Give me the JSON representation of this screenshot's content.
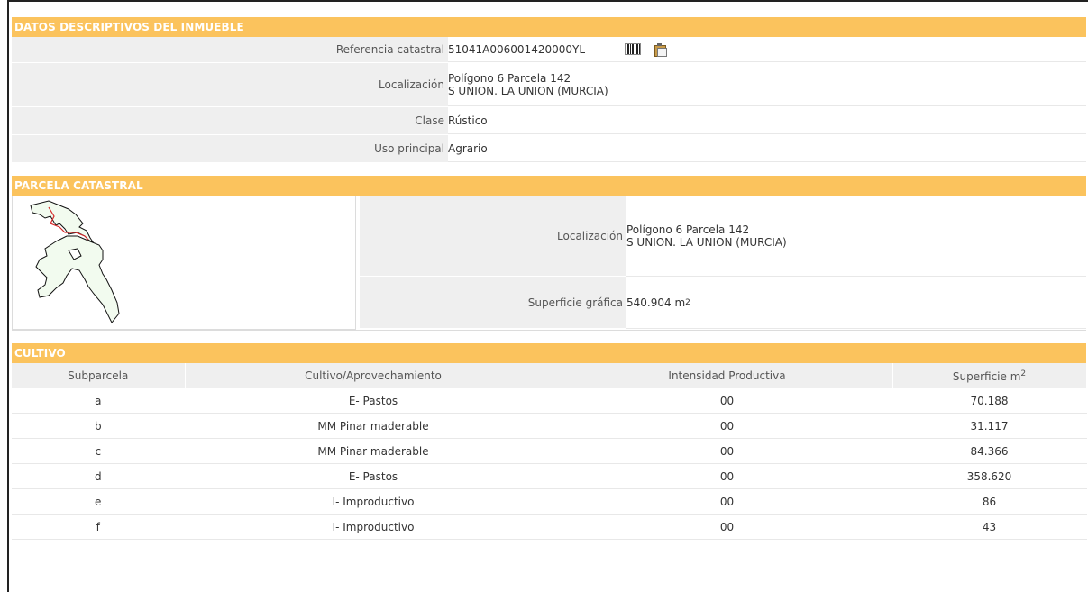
{
  "descriptive": {
    "title": "DATOS DESCRIPTIVOS DEL INMUEBLE",
    "ref_label": "Referencia catastral",
    "ref_value": "51041A006001420000YL",
    "loc_label": "Localización",
    "loc_line1": "Polígono 6 Parcela 142",
    "loc_line2": "S UNION. LA UNION (MURCIA)",
    "clase_label": "Clase",
    "clase_value": "Rústico",
    "uso_label": "Uso principal",
    "uso_value": "Agrario"
  },
  "parcela": {
    "title": "PARCELA CATASTRAL",
    "loc_label": "Localización",
    "loc_line1": "Polígono 6 Parcela 142",
    "loc_line2": "S UNION. LA UNION (MURCIA)",
    "sup_label": "Superficie gráfica",
    "sup_value": "540.904 m",
    "sup_unit_exp": "2"
  },
  "cultivo": {
    "title": "CULTIVO",
    "headers": {
      "subparcela": "Subparcela",
      "cultivo": "Cultivo/Aprovechamiento",
      "intensidad": "Intensidad Productiva",
      "superficie": "Superficie m",
      "superficie_exp": "2"
    },
    "rows": [
      {
        "sub": "a",
        "cult": "E- Pastos",
        "int": "00",
        "sup": "70.188"
      },
      {
        "sub": "b",
        "cult": "MM Pinar maderable",
        "int": "00",
        "sup": "31.117"
      },
      {
        "sub": "c",
        "cult": "MM Pinar maderable",
        "int": "00",
        "sup": "84.366"
      },
      {
        "sub": "d",
        "cult": "E- Pastos",
        "int": "00",
        "sup": "358.620"
      },
      {
        "sub": "e",
        "cult": "I- Improductivo",
        "int": "00",
        "sup": "86"
      },
      {
        "sub": "f",
        "cult": "I- Improductivo",
        "int": "00",
        "sup": "43"
      }
    ]
  },
  "icons": {
    "barcode": "barcode-icon",
    "clipboard": "clipboard-icon"
  },
  "colors": {
    "header_bg": "#fbc35d",
    "label_bg": "#efefef"
  }
}
